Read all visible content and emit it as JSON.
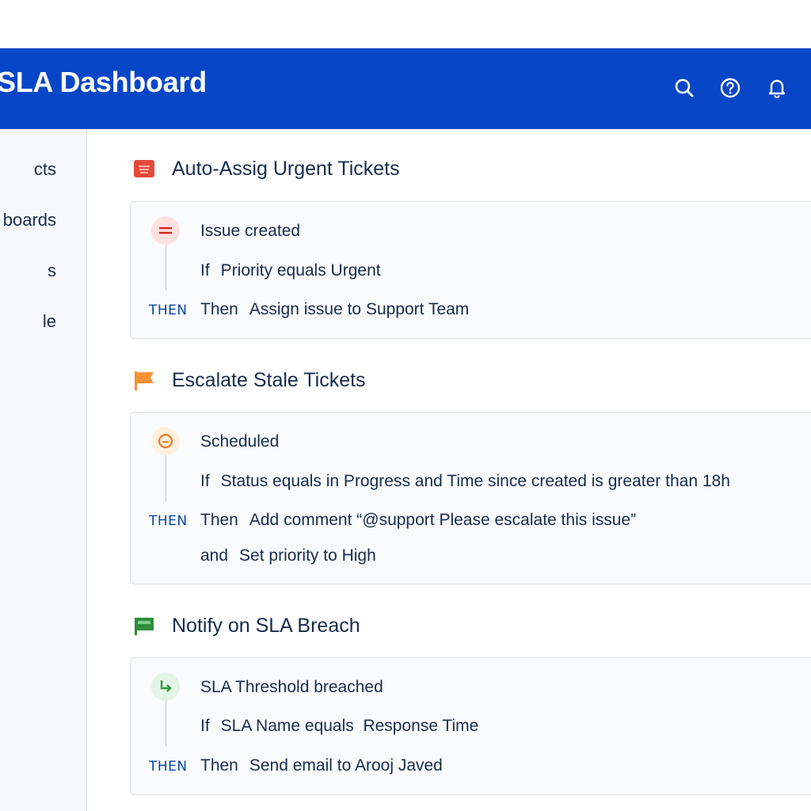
{
  "header": {
    "title": "SLA Dashboard",
    "icons": [
      "search-icon",
      "help-icon",
      "bell-icon"
    ],
    "background": "#0747c7"
  },
  "sidebar": {
    "items": [
      {
        "label": "cts"
      },
      {
        "label": "boards"
      },
      {
        "label": "s"
      },
      {
        "label": "le"
      }
    ]
  },
  "rules": [
    {
      "title": "Auto-Assig Urgent Tickets",
      "icon": "urgent-icon",
      "trigger": "Issue created",
      "condition_keyword": "If",
      "condition": "Priority equals Urgent",
      "then_badge": "THEN",
      "action_keyword": "Then",
      "action": "Assign issue to Support Team"
    },
    {
      "title": "Escalate Stale Tickets",
      "icon": "flag-icon",
      "trigger": "Scheduled",
      "condition_keyword": "If",
      "condition": "Status equals in Progress and Time since created is greater than 18h",
      "then_badge": "THEN",
      "action_keyword": "Then",
      "action": "Add comment “@support Please escalate this issue”",
      "extra_keyword": "and",
      "extra_action": "Set priority to High"
    },
    {
      "title": "Notify on SLA Breach",
      "icon": "banner-icon",
      "trigger": "SLA Threshold breached",
      "condition_keyword": "If",
      "condition": "SLA Name equals  Response Time",
      "then_badge": "THEN",
      "action_keyword": "Then",
      "action": "Send email to Arooj Javed"
    }
  ],
  "colors": {
    "urgent": "#e5493a",
    "flag": "#f79233",
    "banner": "#2f8f3b",
    "then": "#0747a6"
  }
}
